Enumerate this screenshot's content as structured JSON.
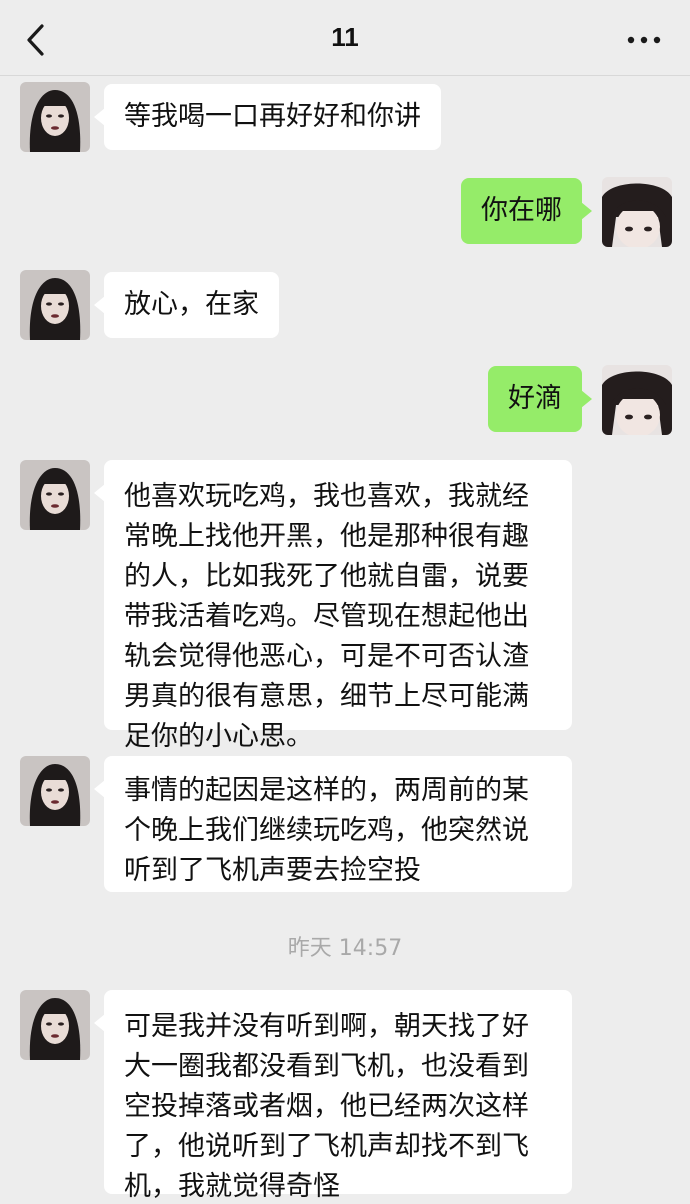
{
  "header": {
    "title": "11",
    "back_icon": "chevron-left-icon",
    "more_icon": "more-dots-icon"
  },
  "messages": [
    {
      "side": "in",
      "text": "等我喝一口再好好和你讲"
    },
    {
      "side": "out",
      "text": "你在哪"
    },
    {
      "side": "in",
      "text": "放心，在家"
    },
    {
      "side": "out",
      "text": "好滴"
    },
    {
      "side": "in",
      "lines": [
        "他喜欢玩吃鸡，我也喜欢，我就经",
        "常晚上找他开黑，他是那种很有趣",
        "的人，比如我死了他就自雷，说要",
        "带我活着吃鸡。尽管现在想起他出",
        "轨会觉得他恶心，可是不可否认渣",
        "男真的很有意思，细节上尽可能满",
        "足你的小心思。"
      ]
    },
    {
      "side": "in",
      "lines": [
        "事情的起因是这样的，两周前的某",
        "个晚上我们继续玩吃鸡，他突然说",
        "听到了飞机声要去捡空投"
      ]
    },
    {
      "side": "in",
      "lines": [
        "可是我并没有听到啊，朝天找了好",
        "大一圈我都没看到飞机，也没看到",
        "空投掉落或者烟，他已经两次这样",
        "了，他说听到了飞机声却找不到飞",
        "机，我就觉得奇怪"
      ]
    }
  ],
  "timestamp": "昨天 14:57",
  "colors": {
    "background": "#ededed",
    "incoming_bubble": "#ffffff",
    "outgoing_bubble": "#95ec69",
    "timestamp": "#a9a9a9"
  }
}
